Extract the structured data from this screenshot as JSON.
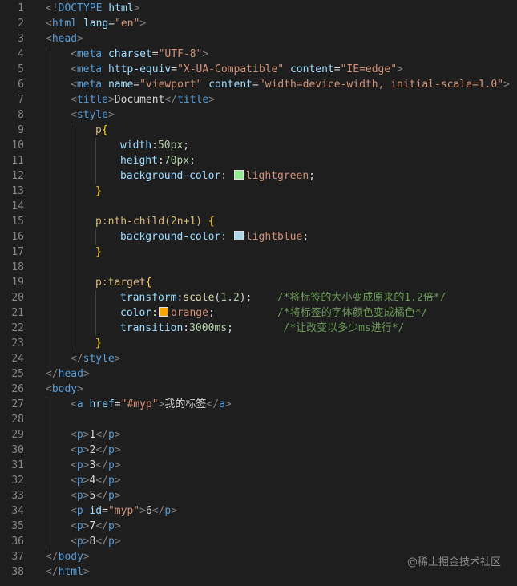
{
  "editor": {
    "lines": [
      {
        "n": "1",
        "indent": 0,
        "tokens": [
          {
            "t": "angle",
            "v": "<!"
          },
          {
            "t": "tag",
            "v": "DOCTYPE"
          },
          {
            "t": "text",
            "v": " "
          },
          {
            "t": "attr",
            "v": "html"
          },
          {
            "t": "angle",
            "v": ">"
          }
        ]
      },
      {
        "n": "2",
        "indent": 0,
        "tokens": [
          {
            "t": "angle",
            "v": "<"
          },
          {
            "t": "tag",
            "v": "html"
          },
          {
            "t": "text",
            "v": " "
          },
          {
            "t": "attr",
            "v": "lang"
          },
          {
            "t": "text",
            "v": "="
          },
          {
            "t": "str",
            "v": "\"en\""
          },
          {
            "t": "angle",
            "v": ">"
          }
        ]
      },
      {
        "n": "3",
        "indent": 0,
        "tokens": [
          {
            "t": "angle",
            "v": "<"
          },
          {
            "t": "tag",
            "v": "head"
          },
          {
            "t": "angle",
            "v": ">"
          }
        ]
      },
      {
        "n": "4",
        "indent": 1,
        "tokens": [
          {
            "t": "angle",
            "v": "<"
          },
          {
            "t": "tag",
            "v": "meta"
          },
          {
            "t": "text",
            "v": " "
          },
          {
            "t": "attr",
            "v": "charset"
          },
          {
            "t": "text",
            "v": "="
          },
          {
            "t": "str",
            "v": "\"UTF-8\""
          },
          {
            "t": "angle",
            "v": ">"
          }
        ]
      },
      {
        "n": "5",
        "indent": 1,
        "tokens": [
          {
            "t": "angle",
            "v": "<"
          },
          {
            "t": "tag",
            "v": "meta"
          },
          {
            "t": "text",
            "v": " "
          },
          {
            "t": "attr",
            "v": "http-equiv"
          },
          {
            "t": "text",
            "v": "="
          },
          {
            "t": "str",
            "v": "\"X-UA-Compatible\""
          },
          {
            "t": "text",
            "v": " "
          },
          {
            "t": "attr",
            "v": "content"
          },
          {
            "t": "text",
            "v": "="
          },
          {
            "t": "str",
            "v": "\"IE=edge\""
          },
          {
            "t": "angle",
            "v": ">"
          }
        ]
      },
      {
        "n": "6",
        "indent": 1,
        "tokens": [
          {
            "t": "angle",
            "v": "<"
          },
          {
            "t": "tag",
            "v": "meta"
          },
          {
            "t": "text",
            "v": " "
          },
          {
            "t": "attr",
            "v": "name"
          },
          {
            "t": "text",
            "v": "="
          },
          {
            "t": "str",
            "v": "\"viewport\""
          },
          {
            "t": "text",
            "v": " "
          },
          {
            "t": "attr",
            "v": "content"
          },
          {
            "t": "text",
            "v": "="
          },
          {
            "t": "str",
            "v": "\"width=device-width, initial-scale=1.0\""
          },
          {
            "t": "angle",
            "v": ">"
          }
        ]
      },
      {
        "n": "7",
        "indent": 1,
        "tokens": [
          {
            "t": "angle",
            "v": "<"
          },
          {
            "t": "tag",
            "v": "title"
          },
          {
            "t": "angle",
            "v": ">"
          },
          {
            "t": "text",
            "v": "Document"
          },
          {
            "t": "angle",
            "v": "</"
          },
          {
            "t": "tag",
            "v": "title"
          },
          {
            "t": "angle",
            "v": ">"
          }
        ]
      },
      {
        "n": "8",
        "indent": 1,
        "tokens": [
          {
            "t": "angle",
            "v": "<"
          },
          {
            "t": "tag",
            "v": "style"
          },
          {
            "t": "angle",
            "v": ">"
          }
        ]
      },
      {
        "n": "9",
        "indent": 2,
        "tokens": [
          {
            "t": "sel",
            "v": "p"
          },
          {
            "t": "brace",
            "v": "{"
          }
        ]
      },
      {
        "n": "10",
        "indent": 3,
        "tokens": [
          {
            "t": "prop",
            "v": "width"
          },
          {
            "t": "punc",
            "v": ":"
          },
          {
            "t": "num",
            "v": "50px"
          },
          {
            "t": "punc",
            "v": ";"
          }
        ]
      },
      {
        "n": "11",
        "indent": 3,
        "tokens": [
          {
            "t": "prop",
            "v": "height"
          },
          {
            "t": "punc",
            "v": ":"
          },
          {
            "t": "num",
            "v": "70px"
          },
          {
            "t": "punc",
            "v": ";"
          }
        ]
      },
      {
        "n": "12",
        "indent": 3,
        "tokens": [
          {
            "t": "prop",
            "v": "background-color"
          },
          {
            "t": "punc",
            "v": ": "
          },
          {
            "t": "swatch",
            "v": "#90ee90"
          },
          {
            "t": "val",
            "v": "lightgreen"
          },
          {
            "t": "punc",
            "v": ";"
          }
        ]
      },
      {
        "n": "13",
        "indent": 2,
        "tokens": [
          {
            "t": "brace",
            "v": "}"
          }
        ]
      },
      {
        "n": "14",
        "indent": 2,
        "tokens": []
      },
      {
        "n": "15",
        "indent": 2,
        "tokens": [
          {
            "t": "sel",
            "v": "p:nth-child(2n+1)"
          },
          {
            "t": "text",
            "v": " "
          },
          {
            "t": "brace",
            "v": "{"
          }
        ]
      },
      {
        "n": "16",
        "indent": 3,
        "tokens": [
          {
            "t": "prop",
            "v": "background-color"
          },
          {
            "t": "punc",
            "v": ": "
          },
          {
            "t": "swatch",
            "v": "#add8e6"
          },
          {
            "t": "val",
            "v": "lightblue"
          },
          {
            "t": "punc",
            "v": ";"
          }
        ]
      },
      {
        "n": "17",
        "indent": 2,
        "tokens": [
          {
            "t": "brace",
            "v": "}"
          }
        ]
      },
      {
        "n": "18",
        "indent": 2,
        "tokens": []
      },
      {
        "n": "19",
        "indent": 2,
        "tokens": [
          {
            "t": "sel",
            "v": "p:target"
          },
          {
            "t": "brace",
            "v": "{"
          }
        ]
      },
      {
        "n": "20",
        "indent": 3,
        "tokens": [
          {
            "t": "prop",
            "v": "transform"
          },
          {
            "t": "punc",
            "v": ":"
          },
          {
            "t": "func",
            "v": "scale"
          },
          {
            "t": "punc",
            "v": "("
          },
          {
            "t": "num",
            "v": "1.2"
          },
          {
            "t": "punc",
            "v": ");"
          },
          {
            "t": "text",
            "v": "    "
          },
          {
            "t": "comment",
            "v": "/*将标签的大小变成原来的1.2倍*/"
          }
        ]
      },
      {
        "n": "21",
        "indent": 3,
        "tokens": [
          {
            "t": "prop",
            "v": "color"
          },
          {
            "t": "punc",
            "v": ":"
          },
          {
            "t": "swatch",
            "v": "#ffa500"
          },
          {
            "t": "val",
            "v": "orange"
          },
          {
            "t": "punc",
            "v": ";"
          },
          {
            "t": "text",
            "v": "          "
          },
          {
            "t": "comment",
            "v": "/*将标签的字体颜色变成橘色*/"
          }
        ]
      },
      {
        "n": "22",
        "indent": 3,
        "tokens": [
          {
            "t": "prop",
            "v": "transition"
          },
          {
            "t": "punc",
            "v": ":"
          },
          {
            "t": "num",
            "v": "3000ms"
          },
          {
            "t": "punc",
            "v": ";"
          },
          {
            "t": "text",
            "v": "        "
          },
          {
            "t": "comment",
            "v": "/*让改变以多少ms进行*/"
          }
        ]
      },
      {
        "n": "23",
        "indent": 2,
        "tokens": [
          {
            "t": "brace",
            "v": "}"
          }
        ]
      },
      {
        "n": "24",
        "indent": 1,
        "tokens": [
          {
            "t": "angle",
            "v": "</"
          },
          {
            "t": "tag",
            "v": "style"
          },
          {
            "t": "angle",
            "v": ">"
          }
        ]
      },
      {
        "n": "25",
        "indent": 0,
        "tokens": [
          {
            "t": "angle",
            "v": "</"
          },
          {
            "t": "tag",
            "v": "head"
          },
          {
            "t": "angle",
            "v": ">"
          }
        ]
      },
      {
        "n": "26",
        "indent": 0,
        "tokens": [
          {
            "t": "angle",
            "v": "<"
          },
          {
            "t": "tag",
            "v": "body"
          },
          {
            "t": "angle",
            "v": ">"
          }
        ]
      },
      {
        "n": "27",
        "indent": 1,
        "tokens": [
          {
            "t": "angle",
            "v": "<"
          },
          {
            "t": "tag",
            "v": "a"
          },
          {
            "t": "text",
            "v": " "
          },
          {
            "t": "attr",
            "v": "href"
          },
          {
            "t": "text",
            "v": "="
          },
          {
            "t": "str",
            "v": "\"#myp\""
          },
          {
            "t": "angle",
            "v": ">"
          },
          {
            "t": "text",
            "v": "我的标签"
          },
          {
            "t": "angle",
            "v": "</"
          },
          {
            "t": "tag",
            "v": "a"
          },
          {
            "t": "angle",
            "v": ">"
          }
        ]
      },
      {
        "n": "28",
        "indent": 1,
        "tokens": []
      },
      {
        "n": "29",
        "indent": 1,
        "tokens": [
          {
            "t": "angle",
            "v": "<"
          },
          {
            "t": "tag",
            "v": "p"
          },
          {
            "t": "angle",
            "v": ">"
          },
          {
            "t": "text",
            "v": "1"
          },
          {
            "t": "angle",
            "v": "</"
          },
          {
            "t": "tag",
            "v": "p"
          },
          {
            "t": "angle",
            "v": ">"
          }
        ]
      },
      {
        "n": "30",
        "indent": 1,
        "tokens": [
          {
            "t": "angle",
            "v": "<"
          },
          {
            "t": "tag",
            "v": "p"
          },
          {
            "t": "angle",
            "v": ">"
          },
          {
            "t": "text",
            "v": "2"
          },
          {
            "t": "angle",
            "v": "</"
          },
          {
            "t": "tag",
            "v": "p"
          },
          {
            "t": "angle",
            "v": ">"
          }
        ]
      },
      {
        "n": "31",
        "indent": 1,
        "tokens": [
          {
            "t": "angle",
            "v": "<"
          },
          {
            "t": "tag",
            "v": "p"
          },
          {
            "t": "angle",
            "v": ">"
          },
          {
            "t": "text",
            "v": "3"
          },
          {
            "t": "angle",
            "v": "</"
          },
          {
            "t": "tag",
            "v": "p"
          },
          {
            "t": "angle",
            "v": ">"
          }
        ]
      },
      {
        "n": "32",
        "indent": 1,
        "tokens": [
          {
            "t": "angle",
            "v": "<"
          },
          {
            "t": "tag",
            "v": "p"
          },
          {
            "t": "angle",
            "v": ">"
          },
          {
            "t": "text",
            "v": "4"
          },
          {
            "t": "angle",
            "v": "</"
          },
          {
            "t": "tag",
            "v": "p"
          },
          {
            "t": "angle",
            "v": ">"
          }
        ]
      },
      {
        "n": "33",
        "indent": 1,
        "tokens": [
          {
            "t": "angle",
            "v": "<"
          },
          {
            "t": "tag",
            "v": "p"
          },
          {
            "t": "angle",
            "v": ">"
          },
          {
            "t": "text",
            "v": "5"
          },
          {
            "t": "angle",
            "v": "</"
          },
          {
            "t": "tag",
            "v": "p"
          },
          {
            "t": "angle",
            "v": ">"
          }
        ]
      },
      {
        "n": "34",
        "indent": 1,
        "tokens": [
          {
            "t": "angle",
            "v": "<"
          },
          {
            "t": "tag",
            "v": "p"
          },
          {
            "t": "text",
            "v": " "
          },
          {
            "t": "attr",
            "v": "id"
          },
          {
            "t": "text",
            "v": "="
          },
          {
            "t": "str",
            "v": "\"myp\""
          },
          {
            "t": "angle",
            "v": ">"
          },
          {
            "t": "text",
            "v": "6"
          },
          {
            "t": "angle",
            "v": "</"
          },
          {
            "t": "tag",
            "v": "p"
          },
          {
            "t": "angle",
            "v": ">"
          }
        ]
      },
      {
        "n": "35",
        "indent": 1,
        "tokens": [
          {
            "t": "angle",
            "v": "<"
          },
          {
            "t": "tag",
            "v": "p"
          },
          {
            "t": "angle",
            "v": ">"
          },
          {
            "t": "text",
            "v": "7"
          },
          {
            "t": "angle",
            "v": "</"
          },
          {
            "t": "tag",
            "v": "p"
          },
          {
            "t": "angle",
            "v": ">"
          }
        ]
      },
      {
        "n": "36",
        "indent": 1,
        "tokens": [
          {
            "t": "angle",
            "v": "<"
          },
          {
            "t": "tag",
            "v": "p"
          },
          {
            "t": "angle",
            "v": ">"
          },
          {
            "t": "text",
            "v": "8"
          },
          {
            "t": "angle",
            "v": "</"
          },
          {
            "t": "tag",
            "v": "p"
          },
          {
            "t": "angle",
            "v": ">"
          }
        ]
      },
      {
        "n": "37",
        "indent": 0,
        "tokens": [
          {
            "t": "angle",
            "v": "</"
          },
          {
            "t": "tag",
            "v": "body"
          },
          {
            "t": "angle",
            "v": ">"
          }
        ]
      },
      {
        "n": "38",
        "indent": 0,
        "tokens": [
          {
            "t": "angle",
            "v": "</"
          },
          {
            "t": "tag",
            "v": "html"
          },
          {
            "t": "angle",
            "v": ">"
          }
        ]
      }
    ]
  },
  "watermark": "@稀土掘金技术社区",
  "colors": {
    "background": "#1e1e1e",
    "line_number": "#858585",
    "tag": "#569cd6",
    "attribute": "#9cdcfe",
    "string": "#ce9178",
    "selector": "#d7ba7d",
    "number": "#b5cea8",
    "comment": "#6a9955",
    "brace": "#ffd700"
  }
}
